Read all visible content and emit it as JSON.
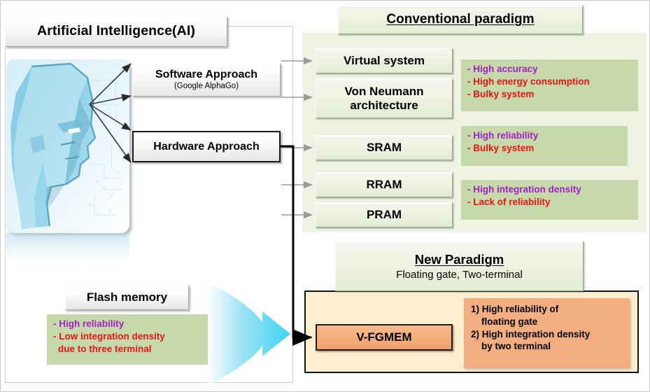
{
  "ai": {
    "title": "Artificial Intelligence(AI)",
    "head_icon": "human-head-profile-icon",
    "approaches": [
      {
        "name": "software",
        "label": "Software Approach",
        "sublabel": "(Google AlphaGo)"
      },
      {
        "name": "hardware",
        "label": "Hardware Approach",
        "sublabel": ""
      }
    ]
  },
  "conventional": {
    "title": "Conventional paradigm",
    "items": [
      {
        "id": "virtual",
        "label": "Virtual  system"
      },
      {
        "id": "vonneumann",
        "label": "Von Neumann architecture"
      },
      {
        "id": "sram",
        "label": "SRAM"
      },
      {
        "id": "rram",
        "label": "RRAM"
      },
      {
        "id": "pram",
        "label": "PRAM"
      }
    ],
    "notes": [
      {
        "id": "note-virtual-vonneumann",
        "lines": [
          {
            "text": "- High accuracy",
            "tone": "positive"
          },
          {
            "text": "- High energy  consumption",
            "tone": "negative"
          },
          {
            "text": "- Bulky system",
            "tone": "negative"
          }
        ]
      },
      {
        "id": "note-sram",
        "lines": [
          {
            "text": "- High reliability",
            "tone": "positive"
          },
          {
            "text": "- Bulky system",
            "tone": "negative"
          }
        ]
      },
      {
        "id": "note-rram-pram",
        "lines": [
          {
            "text": "- High integration density",
            "tone": "positive"
          },
          {
            "text": "- Lack of reliability",
            "tone": "negative"
          }
        ]
      }
    ]
  },
  "flash": {
    "title": "Flash memory",
    "note": {
      "lines": [
        {
          "text": "- High reliability",
          "tone": "positive"
        },
        {
          "text": "- Low integration density",
          "tone": "negative"
        },
        {
          "text": "due to three terminal",
          "tone": "negative",
          "indent": true
        }
      ]
    },
    "arrow_icon": "big-cyan-right-arrow-icon"
  },
  "new_paradigm": {
    "title": "New Paradigm",
    "subtitle": "Floating gate, Two-terminal",
    "device": "V-FGMEM",
    "benefits": [
      "1) High reliability of",
      "floating gate",
      "2) High integration density",
      "by two terminal"
    ]
  },
  "colors": {
    "positive": "#a21fc4",
    "negative": "#e81414",
    "note_bg": "#c6d9ab",
    "panel_bg": "#eef3e4",
    "new_panel_bg": "#fdeece",
    "device_bg": "#f5ae7e",
    "benefit_bg": "#f2ad81",
    "arrow_cyan": "#3fd3f2"
  }
}
